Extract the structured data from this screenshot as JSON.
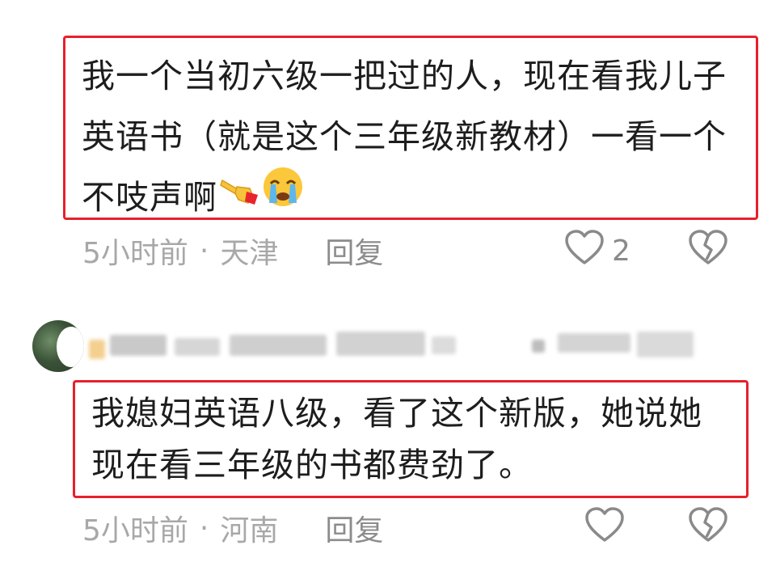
{
  "comments": [
    {
      "text": "我一个当初六级一把过的人，现在看我儿子英语书（就是这个三年级新教材）一看一个不吱声啊",
      "emojis": [
        "pointing-hand-icon",
        "crying-face-icon"
      ],
      "time": "5小时前",
      "separator": "·",
      "location": "天津",
      "reply_label": "回复",
      "like_count": "2",
      "icons": [
        "heart-icon",
        "broken-heart-icon"
      ]
    },
    {
      "text": "我媳妇英语八级，看了这个新版，她说她现在看三年级的书都费劲了。",
      "time": "5小时前",
      "separator": "·",
      "location": "河南",
      "reply_label": "回复",
      "like_count": "",
      "icons": [
        "heart-icon",
        "broken-heart-icon"
      ]
    }
  ],
  "user": {
    "avatar": "avatar",
    "username_state": "blurred"
  },
  "colors": {
    "highlight_border": "#e8202a",
    "meta_text": "#a8a8a8",
    "body_text": "#1d1d1d"
  }
}
